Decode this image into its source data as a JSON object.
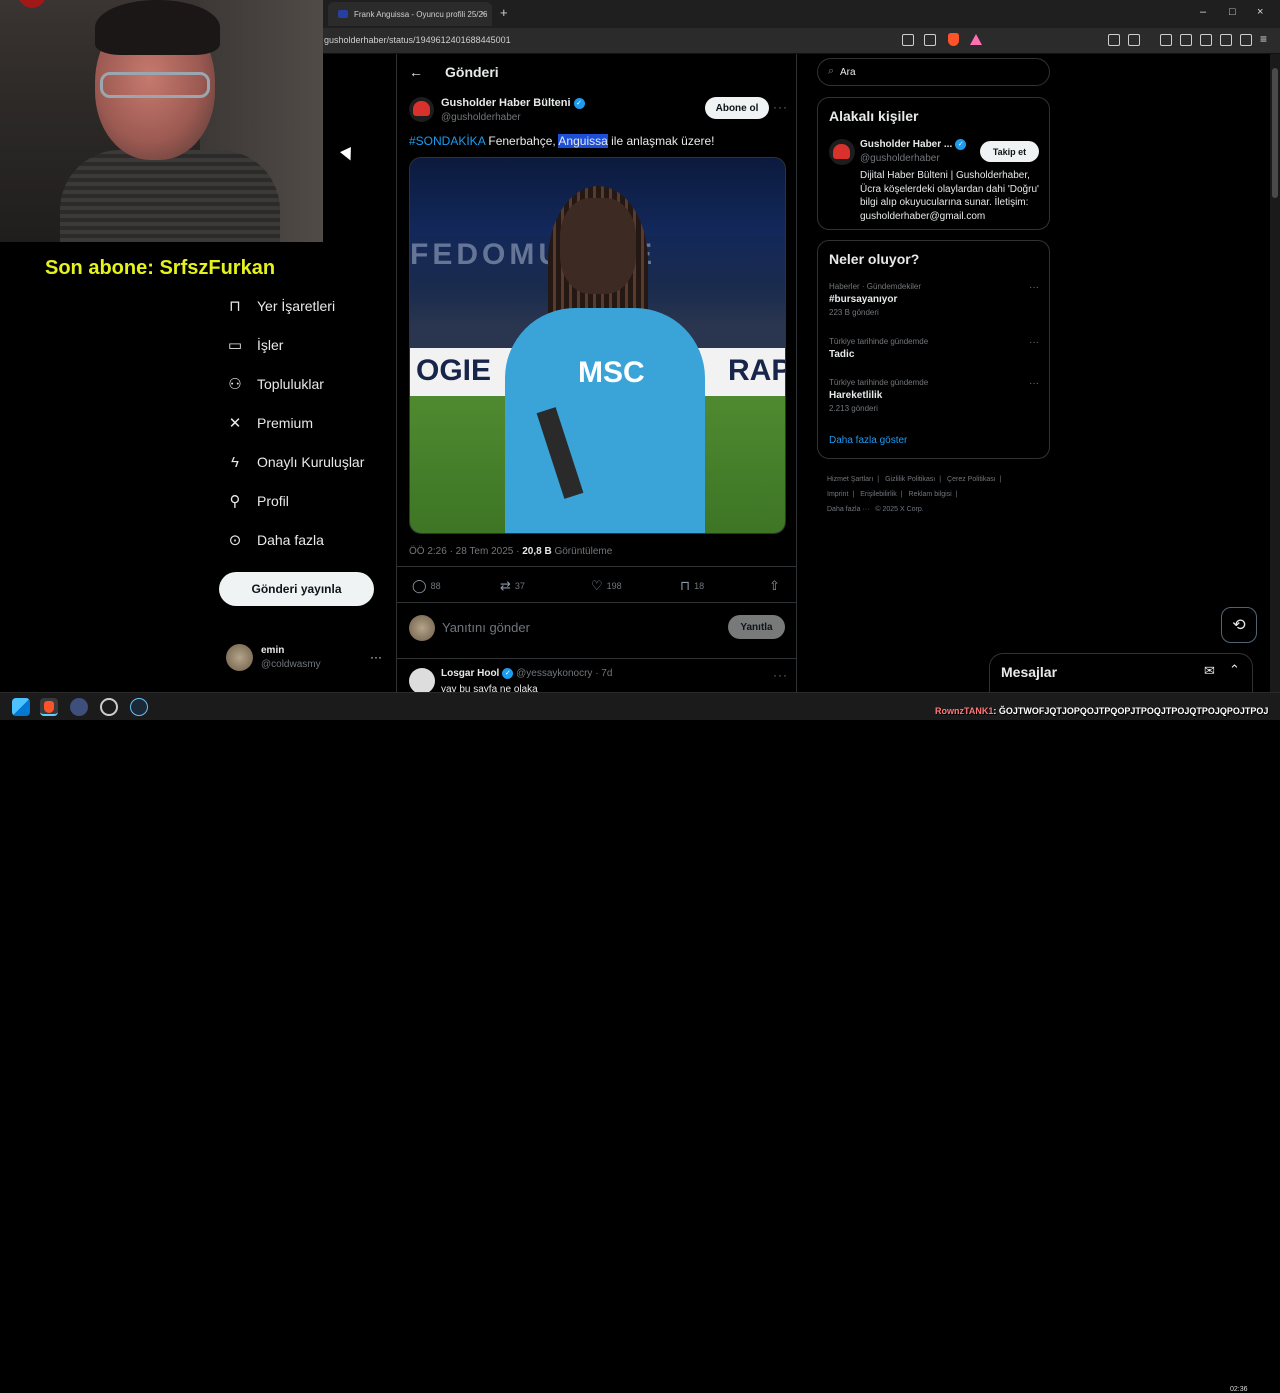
{
  "browser": {
    "tab_title": "Frank Anguissa - Oyuncu profili 25/26",
    "tab_close": "×",
    "new_tab": "+",
    "url": "gusholderhaber/status/1949612401688445001",
    "window_controls": [
      "–",
      "□",
      "×"
    ]
  },
  "overlay": {
    "subscriber": "Son abone: SrfszFurkan",
    "ticker_user": "RownzTANK1",
    "ticker_text": ": ĞOJTWOFJQTJOPQOJTPQOPJTPOQJTPOJQTPOJQPOJTPOJ"
  },
  "nav": {
    "items": [
      {
        "label": "Yer İşaretleri",
        "icon": "bookmark-icon",
        "glyph": "⊓"
      },
      {
        "label": "İşler",
        "icon": "briefcase-icon",
        "glyph": "▭"
      },
      {
        "label": "Topluluklar",
        "icon": "communities-icon",
        "glyph": "⚇"
      },
      {
        "label": "Premium",
        "icon": "x-logo-icon",
        "glyph": "✕"
      },
      {
        "label": "Onaylı Kuruluşlar",
        "icon": "lightning-icon",
        "glyph": "ϟ"
      },
      {
        "label": "Profil",
        "icon": "profile-icon",
        "glyph": "⚲"
      },
      {
        "label": "Daha fazla",
        "icon": "more-circle-icon",
        "glyph": "⊙"
      }
    ],
    "post_button": "Gönderi yayınla",
    "user": {
      "name": "emin",
      "handle": "@coldwasmy",
      "more": "···"
    }
  },
  "post": {
    "header_title": "Gönderi",
    "back_glyph": "←",
    "author_name": "Gusholder Haber Bülteni",
    "author_handle": "@gusholderhaber",
    "subscribe_label": "Abone ol",
    "more": "···",
    "text_hashtag": "#SONDAKİKA",
    "text_part1": " Fenerbahçe, ",
    "text_highlight": "Anguissa",
    "text_part2": " ile anlaşmak üzere!",
    "image_text": {
      "crowd": "FEDOMULTRE",
      "ad_left": "OGIE",
      "ad_right": "RAP",
      "sponsor": "MSC"
    },
    "meta_time": "ÖÖ 2:26 · 28 Tem 2025 · ",
    "meta_views": "20,8 B",
    "meta_views_label": " Görüntüleme",
    "actions": [
      {
        "icon": "reply-icon",
        "glyph": "◯",
        "count": "88"
      },
      {
        "icon": "retweet-icon",
        "glyph": "⇄",
        "count": "37"
      },
      {
        "icon": "like-icon",
        "glyph": "♡",
        "count": "198"
      },
      {
        "icon": "bookmark-icon",
        "glyph": "⊓",
        "count": "18"
      },
      {
        "icon": "share-icon",
        "glyph": "⇧",
        "count": ""
      }
    ],
    "reply_placeholder": "Yanıtını gönder",
    "reply_button": "Yanıtla",
    "next_reply": {
      "name": "Losgar Hool",
      "handle": "@yessaykonocry · 7d",
      "text": "yay bu sayfa ne olaka"
    }
  },
  "sidebar": {
    "search_placeholder": "Ara",
    "related_title": "Alakalı kişiler",
    "related_person": {
      "name": "Gusholder Haber ...",
      "handle": "@gusholderhaber",
      "follow": "Takip et",
      "bio": "Dijital Haber Bülteni | Gusholderhaber, Ücra köşelerdeki olaylardan dahi 'Doğru' bilgi alıp okuyucularına sunar. İletişim: gusholderhaber@gmail.com"
    },
    "trends_title": "Neler oluyor?",
    "trends": [
      {
        "category": "Haberler · Gündemdekiler",
        "name": "#bursayanıyor",
        "count": "223 B gönderi"
      },
      {
        "category": "Türkiye tarihinde gündemde",
        "name": "Tadic",
        "count": ""
      },
      {
        "category": "Türkiye tarihinde gündemde",
        "name": "Hareketlilik",
        "count": "2.213 gönderi"
      }
    ],
    "trend_more": "···",
    "show_more": "Daha fazla göster",
    "footer": [
      "Hizmet Şartları",
      "|",
      "Gizlilik Politikası",
      "|",
      "Çerez Politikası",
      "|",
      "Imprint",
      "|",
      "Erişilebilirlik",
      "|",
      "Reklam bilgisi",
      "|",
      "Daha fazla ···",
      "© 2025 X Corp."
    ]
  },
  "messages": {
    "title": "Mesajlar",
    "compose_glyph": "✉",
    "collapse_glyph": "⌃"
  },
  "grok_glyph": "⟲",
  "taskbar": {
    "clock": "02:36"
  }
}
